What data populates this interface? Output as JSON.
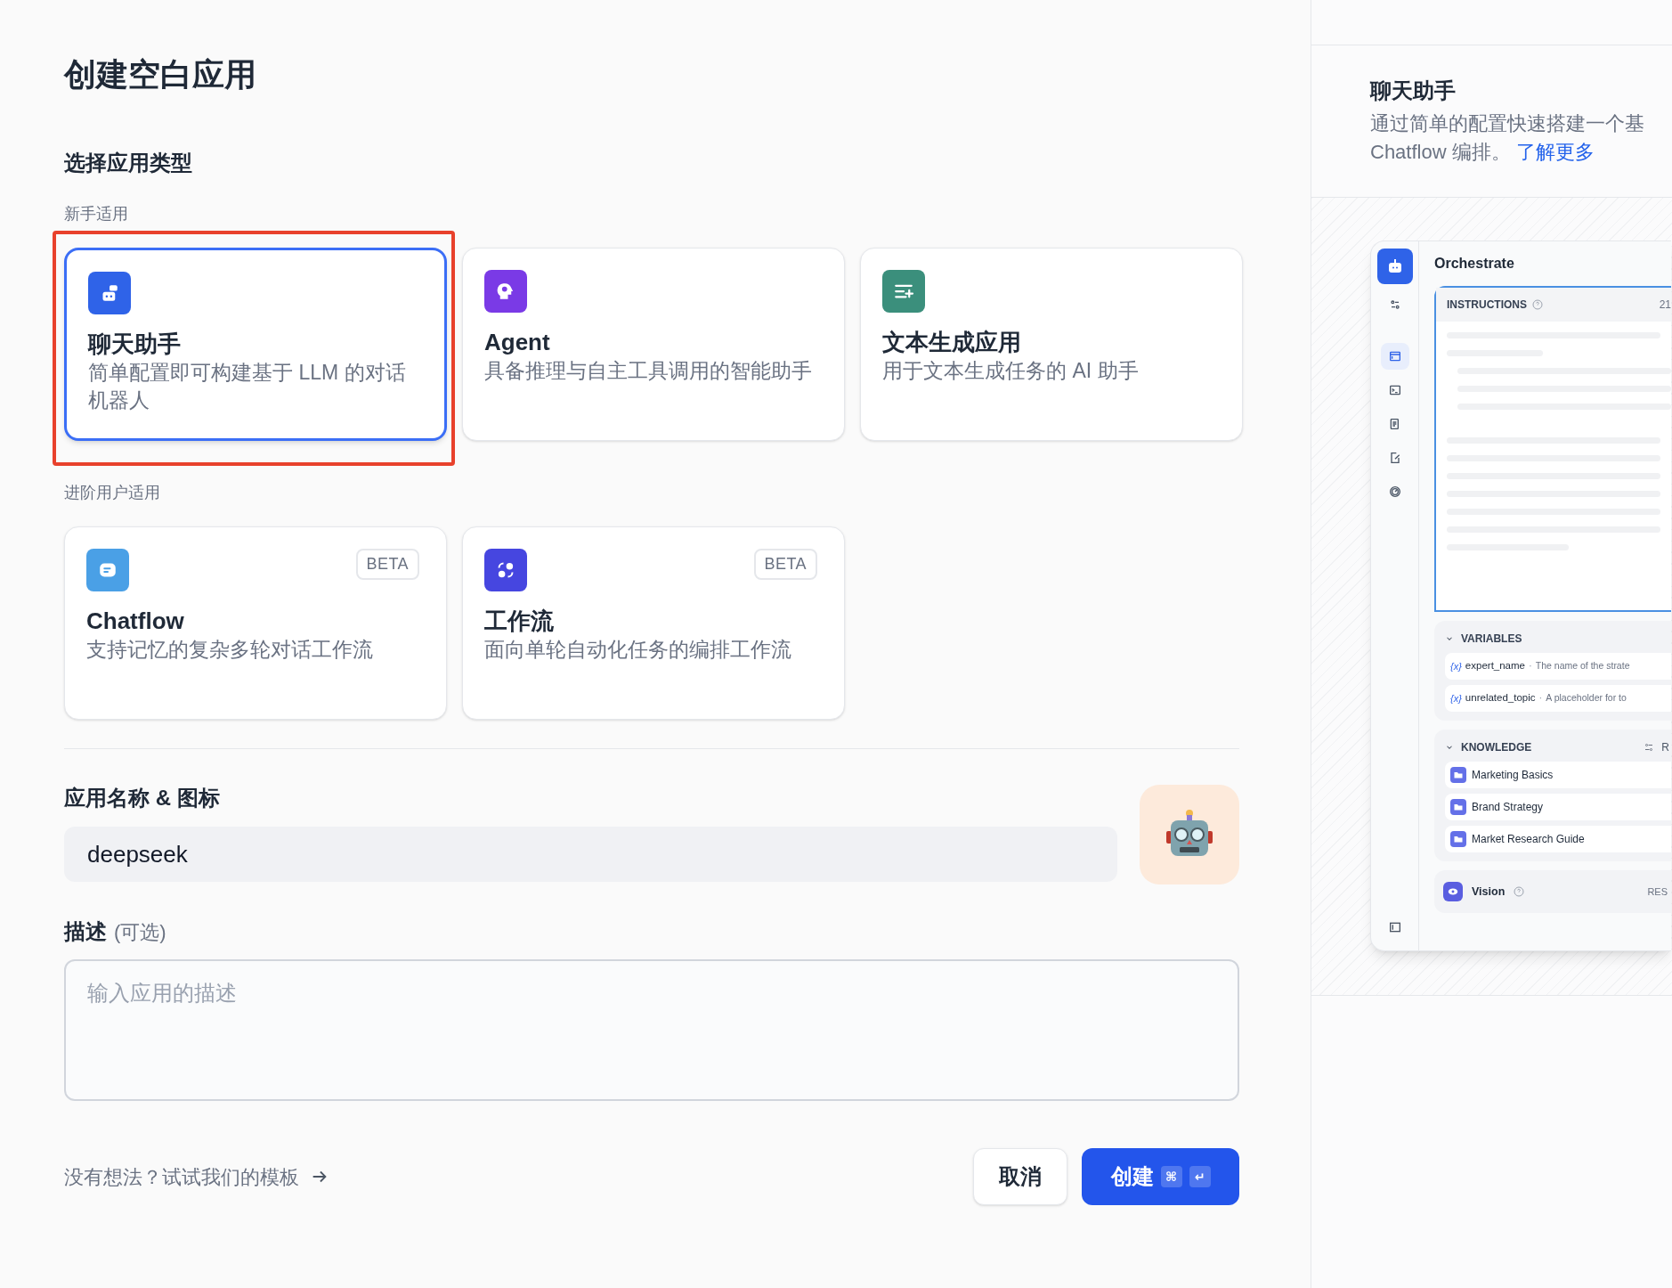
{
  "title": "创建空白应用",
  "type_heading": "选择应用类型",
  "groups": [
    {
      "label": "新手适用",
      "cards": [
        {
          "kind": "chat",
          "title": "聊天助手",
          "description": "简单配置即可构建基于 LLM 的对话机器人",
          "selected": true,
          "highlighted": true
        },
        {
          "kind": "agent",
          "title": "Agent",
          "description": "具备推理与自主工具调用的智能助手",
          "selected": false,
          "highlighted": false
        },
        {
          "kind": "text",
          "title": "文本生成应用",
          "description": "用于文本生成任务的 AI 助手",
          "selected": false,
          "highlighted": false
        }
      ]
    },
    {
      "label": "进阶用户适用",
      "cards": [
        {
          "kind": "chatflow",
          "title": "Chatflow",
          "description": "支持记忆的复杂多轮对话工作流",
          "badge": "BETA",
          "selected": false,
          "highlighted": false
        },
        {
          "kind": "workflow",
          "title": "工作流",
          "description": "面向单轮自动化任务的编排工作流",
          "badge": "BETA",
          "selected": false,
          "highlighted": false
        }
      ]
    }
  ],
  "name_section": {
    "label": "应用名称 & 图标",
    "value": "deepseek"
  },
  "description_section": {
    "label": "描述",
    "hint": "(可选)",
    "placeholder": "输入应用的描述"
  },
  "template_link": "没有想法？试试我们的模板",
  "buttons": {
    "cancel": "取消",
    "create": "创建",
    "shortcut": [
      "⌘",
      "↵"
    ]
  },
  "preview": {
    "title": "聊天助手",
    "description_lines": [
      "通过简单的配置快速搭建一个基",
      "Chatflow 编排。"
    ],
    "link": "了解更多",
    "mock": {
      "heading": "Orchestrate",
      "nav": [
        {
          "kind": "settings",
          "selected": false
        },
        {
          "kind": "window",
          "selected": true
        },
        {
          "kind": "terminal",
          "selected": false
        },
        {
          "kind": "document",
          "selected": false
        },
        {
          "kind": "edit",
          "selected": false
        },
        {
          "kind": "gauge",
          "selected": false
        }
      ],
      "instructions": {
        "label": "INSTRUCTIONS",
        "count": "21"
      },
      "variables": {
        "label": "VARIABLES",
        "items": [
          {
            "marker": "{x}",
            "name": "expert_name",
            "separator": "·",
            "description": "The name of the strate"
          },
          {
            "marker": "{x}",
            "name": "unrelated_topic",
            "separator": "·",
            "description": "A placeholder for to"
          }
        ]
      },
      "knowledge": {
        "label": "KNOWLEDGE",
        "action": "R",
        "items": [
          "Marketing Basics",
          "Brand Strategy",
          "Market Research Guide"
        ]
      },
      "vision": {
        "label": "Vision",
        "value": "RES"
      }
    }
  }
}
